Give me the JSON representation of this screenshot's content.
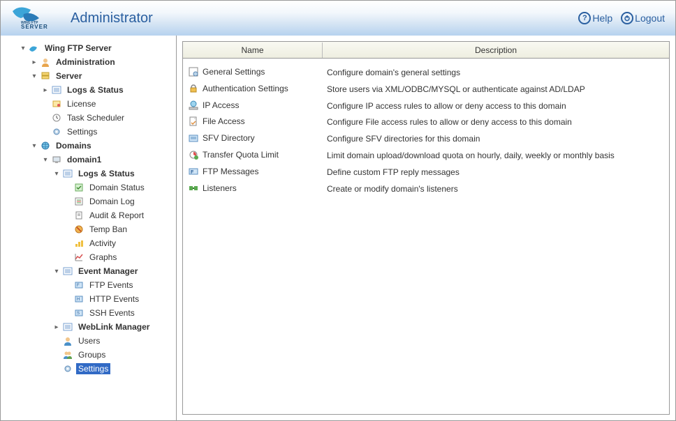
{
  "header": {
    "title": "Administrator",
    "help": "Help",
    "logout": "Logout"
  },
  "tree": {
    "root": "Wing FTP Server",
    "administration": "Administration",
    "server": "Server",
    "server_logs": "Logs & Status",
    "server_license": "License",
    "server_task": "Task Scheduler",
    "server_settings": "Settings",
    "domains": "Domains",
    "domain1": "domain1",
    "d1_logs": "Logs & Status",
    "d1_domain_status": "Domain Status",
    "d1_domain_log": "Domain Log",
    "d1_audit": "Audit & Report",
    "d1_tempban": "Temp Ban",
    "d1_activity": "Activity",
    "d1_graphs": "Graphs",
    "d1_event_mgr": "Event Manager",
    "d1_ftp_events": "FTP Events",
    "d1_http_events": "HTTP Events",
    "d1_ssh_events": "SSH Events",
    "d1_weblink": "WebLink Manager",
    "d1_users": "Users",
    "d1_groups": "Groups",
    "d1_settings": "Settings"
  },
  "table": {
    "col_name": "Name",
    "col_desc": "Description",
    "rows": [
      {
        "name": "General Settings",
        "desc": "Configure domain's general settings"
      },
      {
        "name": "Authentication Settings",
        "desc": "Store users via XML/ODBC/MYSQL or authenticate against AD/LDAP"
      },
      {
        "name": "IP Access",
        "desc": "Configure IP access rules to allow or deny access to this domain"
      },
      {
        "name": "File Access",
        "desc": "Configure File access rules to allow or deny access to this domain"
      },
      {
        "name": "SFV Directory",
        "desc": "Configure SFV directories for this domain"
      },
      {
        "name": "Transfer Quota Limit",
        "desc": "Limit domain upload/download quota on hourly, daily, weekly or monthly basis"
      },
      {
        "name": "FTP Messages",
        "desc": "Define custom FTP reply messages"
      },
      {
        "name": "Listeners",
        "desc": "Create or modify domain's listeners"
      }
    ]
  }
}
